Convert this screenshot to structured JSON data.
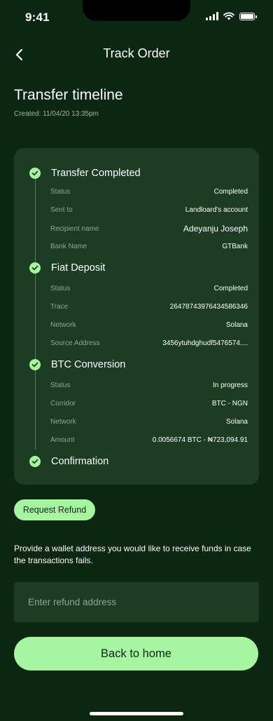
{
  "status_bar": {
    "time": "9:41"
  },
  "header": {
    "title": "Track Order",
    "back_icon": "chevron-left-icon"
  },
  "page": {
    "title": "Transfer timeline",
    "created": "Created: 11/04/20 13:35pm"
  },
  "timeline": {
    "steps": [
      {
        "label": "Transfer Completed",
        "rows": [
          {
            "label": "Status",
            "value": "Completed"
          },
          {
            "label": "Sent to",
            "value": "Landloard's account"
          },
          {
            "label": "Recipient name",
            "value": "Adeyanju Joseph"
          },
          {
            "label": "Bank Name",
            "value": "GTBank"
          }
        ]
      },
      {
        "label": "Fiat Deposit",
        "rows": [
          {
            "label": "Status",
            "value": "Completed"
          },
          {
            "label": "Trace",
            "value": "2647874397643458634​6"
          },
          {
            "label": "Network",
            "value": "Solana"
          },
          {
            "label": "Source Address",
            "value": "3456ytuhdghudf5476574...."
          }
        ]
      },
      {
        "label": "BTC Conversion",
        "rows": [
          {
            "label": "Status",
            "value": "In progress"
          },
          {
            "label": "Corridor",
            "value": "BTC - NGN"
          },
          {
            "label": "Network",
            "value": "Solana"
          },
          {
            "label": "Amount",
            "value": "0.0056674 BTC - ₦723,094.91"
          }
        ]
      },
      {
        "label": "Confirmation",
        "rows": []
      }
    ]
  },
  "refund": {
    "button_label": "Request Refund",
    "description": "Provide a wallet address you would like to receive funds in case the transactions fails.",
    "input_placeholder": "Enter refund address",
    "input_value": ""
  },
  "footer": {
    "home_button_label": "Back to home"
  },
  "colors": {
    "background": "#0b2712",
    "card": "#1c3d22",
    "accent": "#a6f5a0",
    "muted_text": "#8fa693"
  }
}
